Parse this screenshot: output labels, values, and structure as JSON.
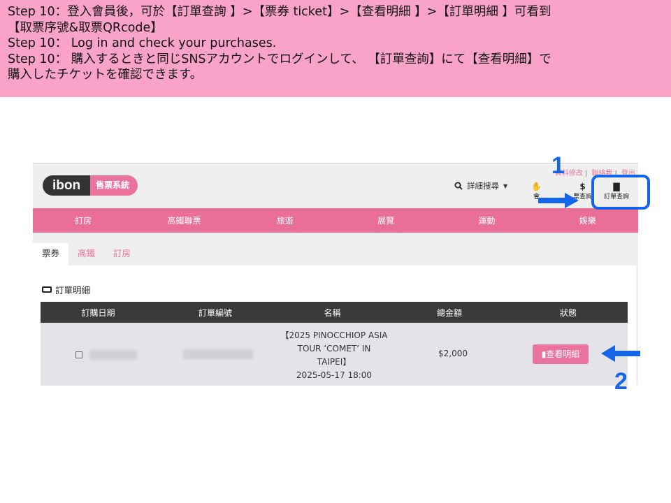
{
  "banner": {
    "line1": "Step 10：登入會員後，可於【訂單查詢 】>【票券 ticket】>【查看明細 】>【訂單明細 】可看到",
    "line2": "【取票序號&取票QRcode】",
    "line3": "Step 10： Log in and check  your purchases.",
    "line4": "Step 10： 購入するときと同じSNSアカウントでログインして、 【訂單查詢】にて【查看明細】で",
    "line5": "購入したチケットを確認できます。"
  },
  "header": {
    "logo_ibon": "ibon",
    "logo_system": "售票系統",
    "links": [
      "資料修改",
      "聯絡我",
      "登出"
    ],
    "search_label": "詳細搜尋",
    "tools": [
      {
        "icon": "handshake-icon",
        "glyph": "✋",
        "label": "會"
      },
      {
        "icon": "ticket-query-icon",
        "glyph": "▮",
        "label": "票查詢"
      },
      {
        "icon": "document-icon",
        "glyph": "▮",
        "label": "訂單查詢"
      }
    ]
  },
  "nav": [
    "訂房",
    "高鐵聯票",
    "旅遊",
    "展覽",
    "運動",
    "娛樂"
  ],
  "tabs": [
    "票券",
    "高鐵",
    "訂房"
  ],
  "section_title": "訂單明細",
  "table": {
    "headers": [
      "訂購日期",
      "訂單編號",
      "名稱",
      "總金額",
      "狀態"
    ],
    "row": {
      "name_line1": "【2025 PINOCCHIOP ASIA",
      "name_line2": "TOUR ‘COMET’ IN",
      "name_line3": "TAIPEI】",
      "name_datetime": "2025-05-17  18:00",
      "amount": "$2,000",
      "button": "查看明細"
    }
  },
  "annotations": {
    "num1": "1",
    "num2": "2",
    "color": "#1565e8"
  },
  "colors": {
    "banner": "#f9a3c8",
    "brand_pink": "#e9739c",
    "nav_pink": "#e96e98",
    "table_header": "#3a3a3a"
  }
}
